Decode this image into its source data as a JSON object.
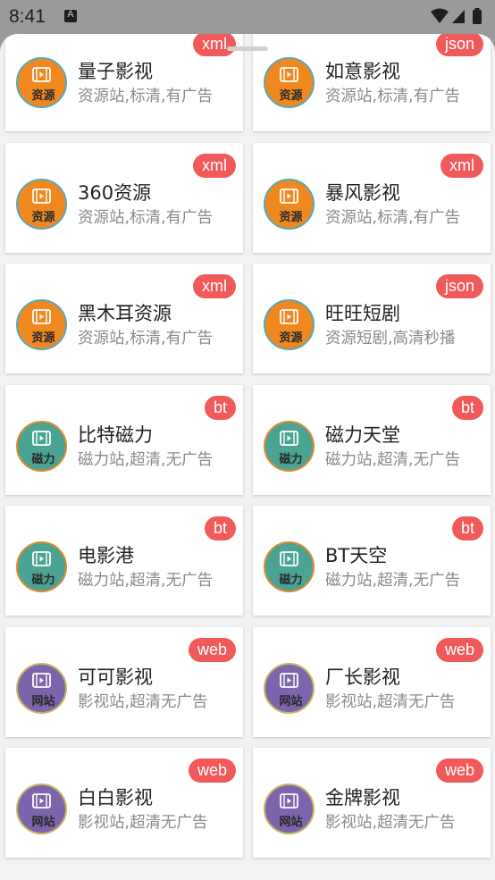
{
  "status_bar": {
    "time": "8:41"
  },
  "colors": {
    "badge": "#f05a5a",
    "resource": "#f08820",
    "magnet": "#4aa393",
    "website": "#7e63ad"
  },
  "cards": [
    {
      "name": "量子影视",
      "desc": "资源站,标清,有广告",
      "badge": "xml",
      "type_label": "资源",
      "type": "orange",
      "icon": "film-icon"
    },
    {
      "name": "如意影视",
      "desc": "资源站,标清,有广告",
      "badge": "json",
      "type_label": "资源",
      "type": "orange",
      "icon": "film-icon"
    },
    {
      "name": "360资源",
      "desc": "资源站,标清,有广告",
      "badge": "xml",
      "type_label": "资源",
      "type": "orange",
      "icon": "film-icon"
    },
    {
      "name": "暴风影视",
      "desc": "资源站,标清,有广告",
      "badge": "xml",
      "type_label": "资源",
      "type": "orange",
      "icon": "film-icon"
    },
    {
      "name": "黑木耳资源",
      "desc": "资源站,标清,有广告",
      "badge": "xml",
      "type_label": "资源",
      "type": "orange",
      "icon": "film-icon"
    },
    {
      "name": "旺旺短剧",
      "desc": "资源短剧,高清秒播",
      "badge": "json",
      "type_label": "资源",
      "type": "orange",
      "icon": "film-icon"
    },
    {
      "name": "比特磁力",
      "desc": "磁力站,超清,无广告",
      "badge": "bt",
      "type_label": "磁力",
      "type": "teal",
      "icon": "film-icon"
    },
    {
      "name": "磁力天堂",
      "desc": "磁力站,超清,无广告",
      "badge": "bt",
      "type_label": "磁力",
      "type": "teal",
      "icon": "film-icon"
    },
    {
      "name": "电影港",
      "desc": "磁力站,超清,无广告",
      "badge": "bt",
      "type_label": "磁力",
      "type": "teal",
      "icon": "film-icon"
    },
    {
      "name": "BT天空",
      "desc": "磁力站,超清,无广告",
      "badge": "bt",
      "type_label": "磁力",
      "type": "teal",
      "icon": "film-icon"
    },
    {
      "name": "可可影视",
      "desc": "影视站,超清无广告",
      "badge": "web",
      "type_label": "网站",
      "type": "purple",
      "icon": "film-icon"
    },
    {
      "name": "厂长影视",
      "desc": "影视站,超清无广告",
      "badge": "web",
      "type_label": "网站",
      "type": "purple",
      "icon": "film-icon"
    },
    {
      "name": "白白影视",
      "desc": "影视站,超清无广告",
      "badge": "web",
      "type_label": "网站",
      "type": "purple",
      "icon": "film-icon"
    },
    {
      "name": "金牌影视",
      "desc": "影视站,超清无广告",
      "badge": "web",
      "type_label": "网站",
      "type": "purple",
      "icon": "film-icon"
    }
  ]
}
